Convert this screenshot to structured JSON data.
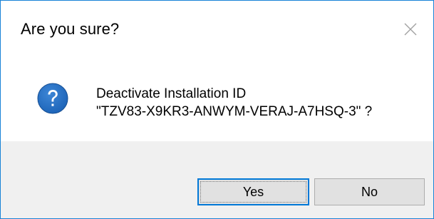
{
  "dialog": {
    "title": "Are you sure?",
    "close_icon": "close-icon",
    "icon": "question-icon",
    "message_line1": "Deactivate Installation ID",
    "message_line2": "\"TZV83-X9KR3-ANWYM-VERAJ-A7HSQ-3\" ?",
    "buttons": {
      "yes_label": "Yes",
      "no_label": "No"
    }
  },
  "colors": {
    "window_border": "#1883d7",
    "footer_background": "#f0f0f0",
    "button_background": "#e1e1e1",
    "default_button_border": "#0078d7",
    "question_icon": "#1c63b7"
  }
}
